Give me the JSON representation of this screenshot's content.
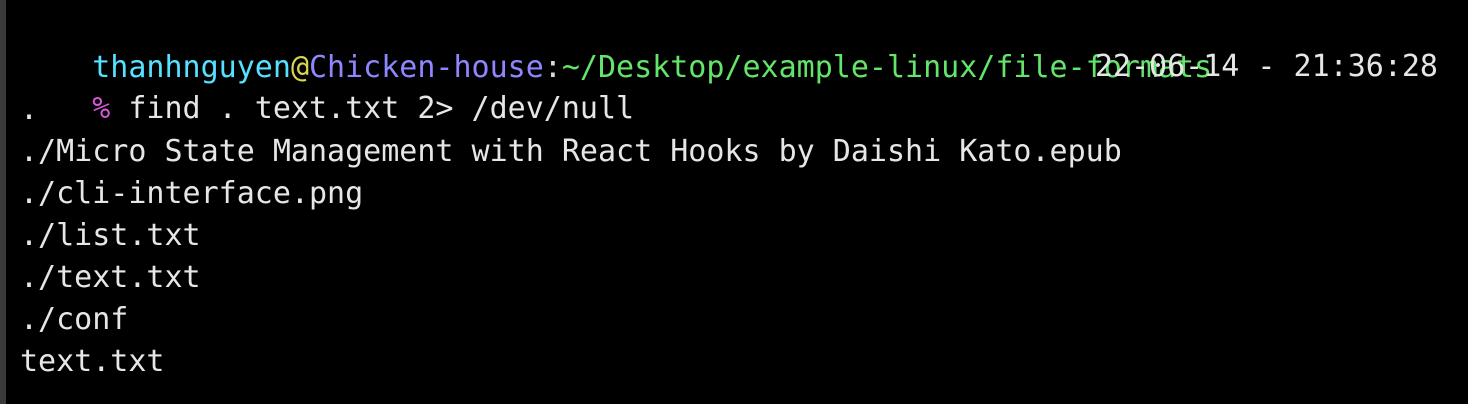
{
  "terminal": {
    "prompt": {
      "user": "thanhnguyen",
      "at": "@",
      "host": "Chicken-house",
      "colon": ":",
      "path": "~/Desktop/example-linux/file-formats"
    },
    "command": {
      "symbol": "%",
      "text": "find . text.txt 2> /dev/null",
      "timestamp": "22-06-14 - 21:36:28"
    },
    "output": [
      ".",
      "./Micro State Management with React Hooks by Daishi Kato.epub",
      "./cli-interface.png",
      "./list.txt",
      "./text.txt",
      "./conf",
      "text.txt"
    ]
  }
}
